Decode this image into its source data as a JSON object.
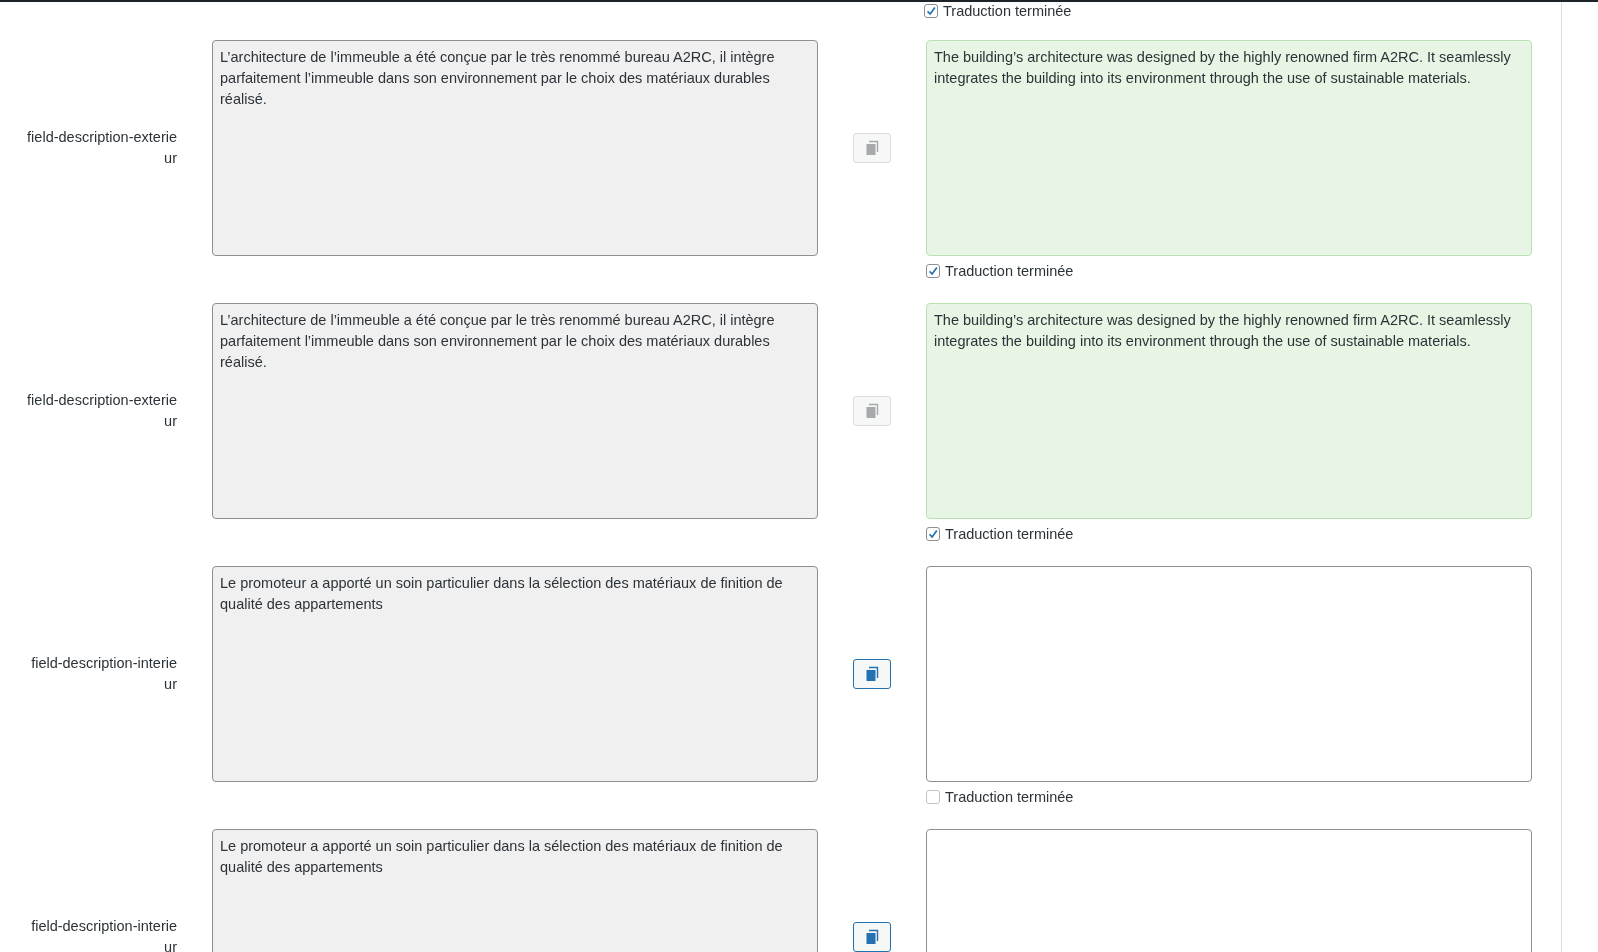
{
  "top_status": {
    "label": "Traduction terminée",
    "checked": true
  },
  "rows": [
    {
      "label": "field-description-exterieur",
      "source": "L’architecture de l’immeuble a été conçue par le très renommé bureau A2RC, il intègre parfaitement l’immeuble dans son environnement par le choix des matériaux durables réalisé.",
      "copy_enabled": false,
      "target": "The building’s architecture was designed by the highly renowned firm A2RC. It seamlessly integrates the building into its environment through the use of sustainable materials.",
      "translated": true,
      "status": {
        "label": "Traduction terminée",
        "checked": true
      }
    },
    {
      "label": "field-description-exterieur",
      "source": "L’architecture de l’immeuble a été conçue par le très renommé bureau A2RC, il intègre parfaitement l’immeuble dans son environnement par le choix des matériaux durables réalisé.",
      "copy_enabled": false,
      "target": "The building’s architecture was designed by the highly renowned firm A2RC. It seamlessly integrates the building into its environment through the use of sustainable materials.",
      "translated": true,
      "status": {
        "label": "Traduction terminée",
        "checked": true
      }
    },
    {
      "label": "field-description-interieur",
      "source": "Le promoteur a apporté un soin particulier dans la sélection des matériaux de finition de qualité des appartements",
      "copy_enabled": true,
      "translated": false,
      "status": {
        "label": "Traduction terminée",
        "checked": false
      }
    },
    {
      "label": "field-description-interieur",
      "source": "Le promoteur a apporté un soin particulier dans la sélection des matériaux de finition de qualité des appartements",
      "copy_enabled": true,
      "translated": false
    }
  ]
}
